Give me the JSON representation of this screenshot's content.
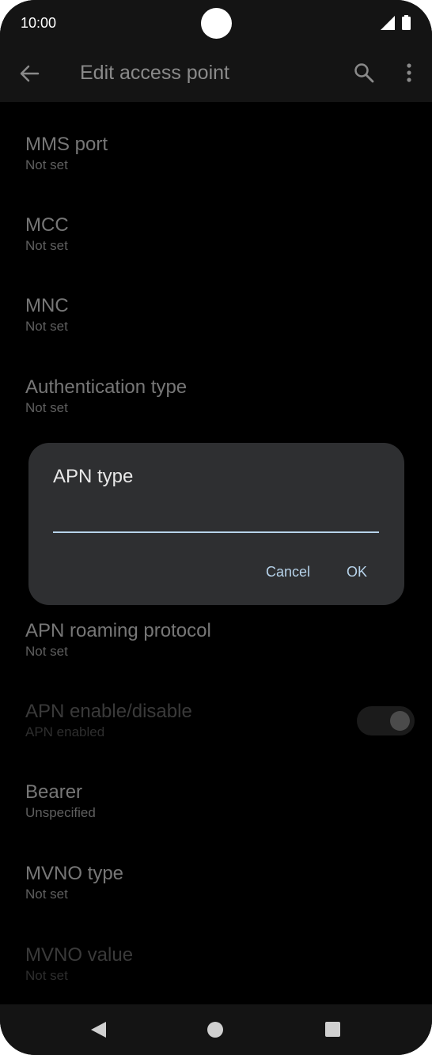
{
  "status_bar": {
    "time": "10:00"
  },
  "app_bar": {
    "title": "Edit access point"
  },
  "preferences": [
    {
      "title": "MMS port",
      "summary": "Not set"
    },
    {
      "title": "MCC",
      "summary": "Not set"
    },
    {
      "title": "MNC",
      "summary": "Not set"
    },
    {
      "title": "Authentication type",
      "summary": "Not set"
    },
    {
      "title": "APN roaming protocol",
      "summary": "Not set"
    },
    {
      "title": "APN enable/disable",
      "summary": "APN enabled",
      "toggle_on": true
    },
    {
      "title": "Bearer",
      "summary": "Unspecified"
    },
    {
      "title": "MVNO type",
      "summary": "Not set"
    },
    {
      "title": "MVNO value",
      "summary": "Not set"
    }
  ],
  "dialog": {
    "title": "APN type",
    "input_value": "",
    "cancel_label": "Cancel",
    "ok_label": "OK"
  },
  "icons": {
    "back": "arrow-back-icon",
    "search": "search-icon",
    "more": "more-vert-icon",
    "signal": "signal-icon",
    "battery": "battery-icon"
  },
  "colors": {
    "accent": "#b7d3ea",
    "dialog_bg": "#2e2f31",
    "background": "#000000"
  }
}
